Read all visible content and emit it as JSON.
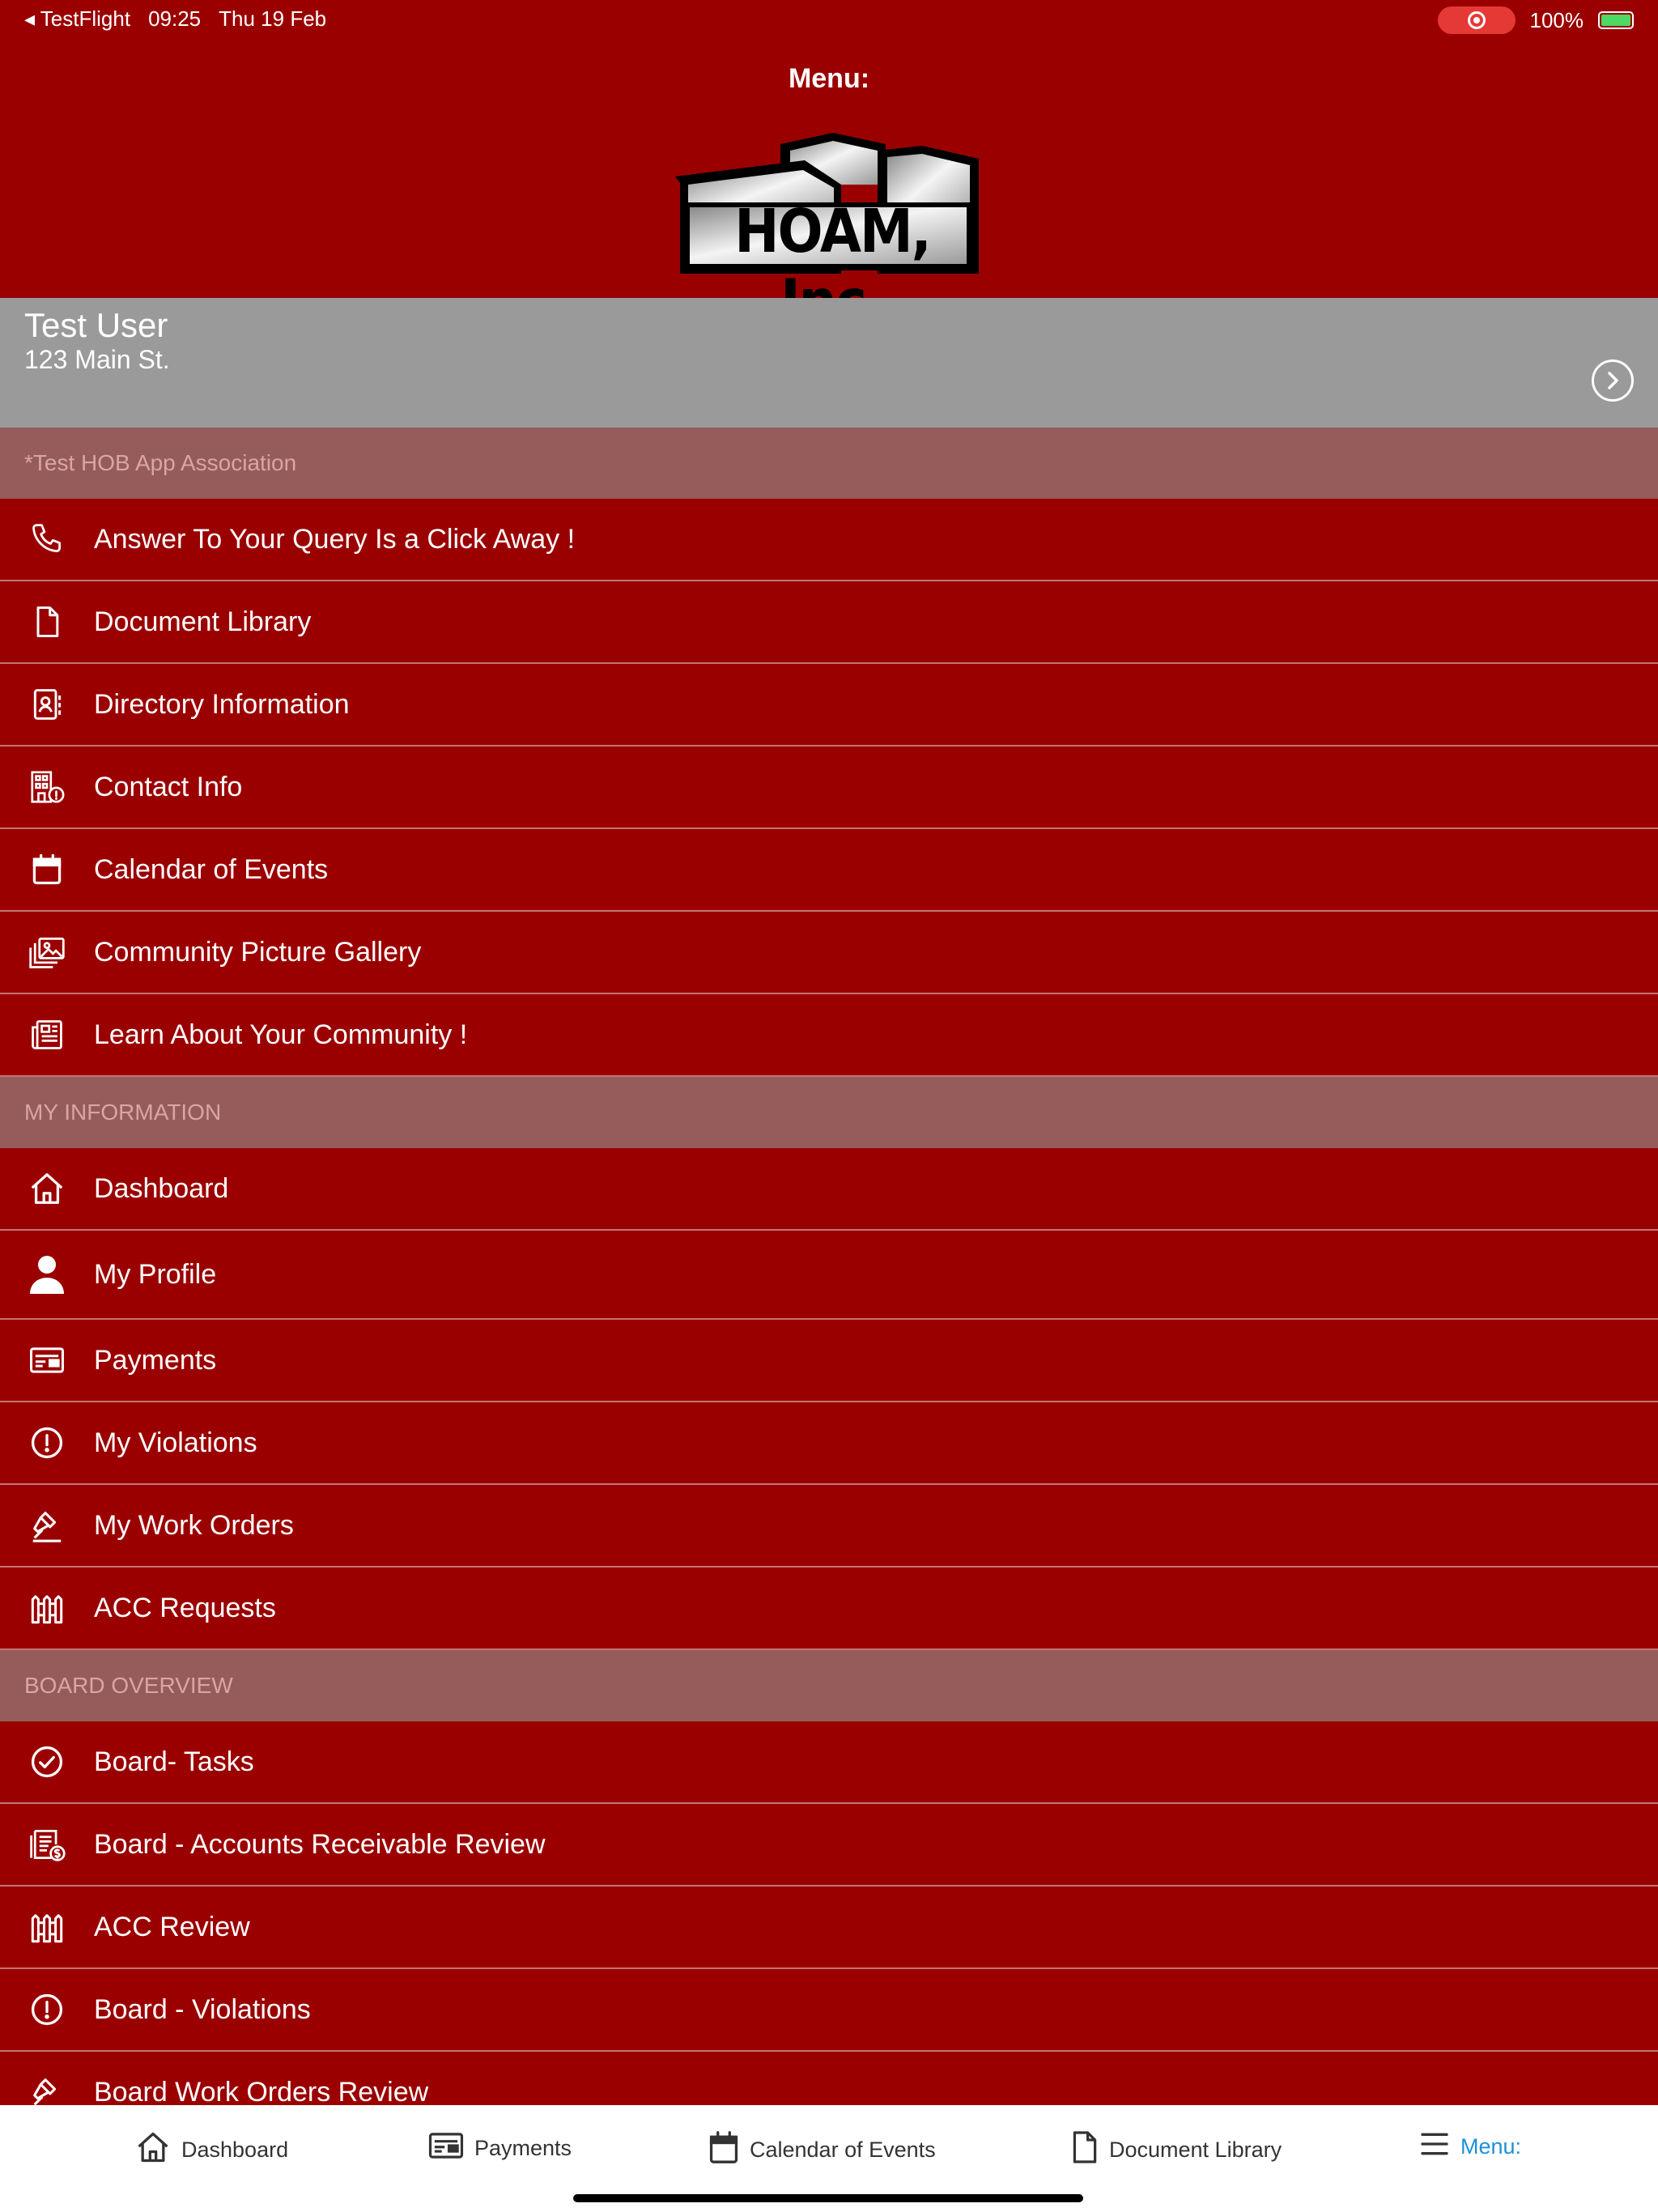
{
  "status_bar": {
    "back_app": "◂ TestFlight",
    "time": "09:25",
    "date": "Thu 19 Feb",
    "battery": "100%"
  },
  "header": {
    "title": "Menu:",
    "logo_text": "HOAM, Inc."
  },
  "user": {
    "name": "Test User",
    "address": "123 Main St."
  },
  "sections": {
    "association": "*Test HOB App Association",
    "my_information": "MY INFORMATION",
    "board_overview": "BOARD OVERVIEW"
  },
  "menu": {
    "association_items": [
      {
        "label": "Answer To Your Query Is a Click Away !",
        "icon": "phone-icon"
      },
      {
        "label": "Document Library",
        "icon": "document-icon"
      },
      {
        "label": "Directory Information",
        "icon": "contact-card-icon"
      },
      {
        "label": "Contact Info",
        "icon": "building-info-icon"
      },
      {
        "label": "Calendar of Events",
        "icon": "calendar-icon"
      },
      {
        "label": "Community Picture Gallery",
        "icon": "gallery-icon"
      },
      {
        "label": "Learn About Your Community !",
        "icon": "newspaper-icon"
      }
    ],
    "my_info_items": [
      {
        "label": "Dashboard",
        "icon": "home-icon"
      },
      {
        "label": "My Profile",
        "icon": "person-icon"
      },
      {
        "label": "Payments",
        "icon": "payment-card-icon"
      },
      {
        "label": "My Violations",
        "icon": "alert-circle-icon"
      },
      {
        "label": "My Work Orders",
        "icon": "gavel-icon"
      },
      {
        "label": "ACC Requests",
        "icon": "fence-icon"
      }
    ],
    "board_items": [
      {
        "label": "Board- Tasks",
        "icon": "check-circle-icon"
      },
      {
        "label": "Board - Accounts Receivable Review",
        "icon": "receivable-icon"
      },
      {
        "label": "ACC Review",
        "icon": "fence-icon"
      },
      {
        "label": "Board - Violations",
        "icon": "alert-circle-icon"
      },
      {
        "label": "Board Work Orders Review",
        "icon": "gavel-icon"
      }
    ]
  },
  "tabbar": {
    "items": [
      {
        "label": "Dashboard",
        "icon": "home-icon"
      },
      {
        "label": "Payments",
        "icon": "payment-card-icon"
      },
      {
        "label": "Calendar of Events",
        "icon": "calendar-icon"
      },
      {
        "label": "Document Library",
        "icon": "document-icon"
      },
      {
        "label": "Menu:",
        "icon": "menu-icon"
      }
    ],
    "active_color": "#1e90d6"
  },
  "colors": {
    "primary": "#9b0000",
    "section_header": "#965c5c",
    "user_card": "#9a9a9a"
  }
}
